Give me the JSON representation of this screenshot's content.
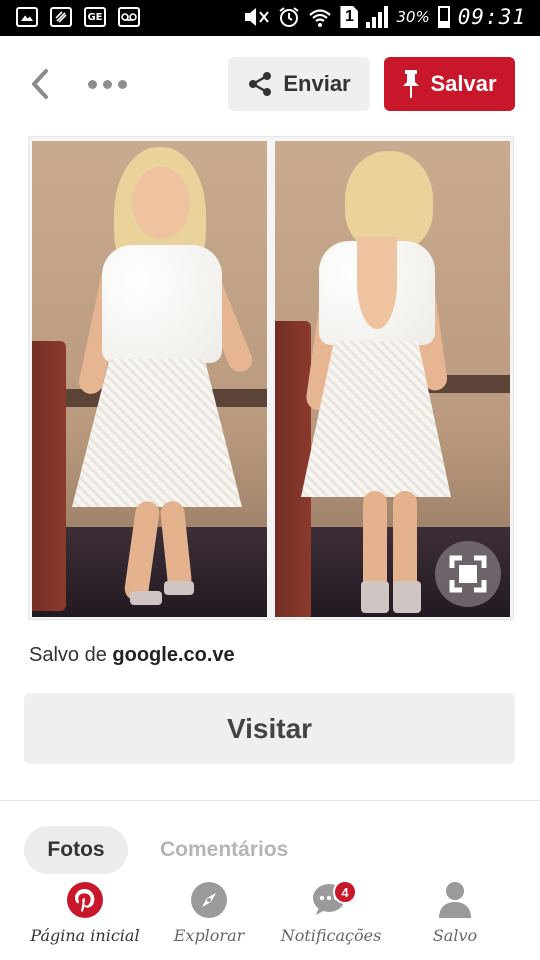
{
  "status_bar": {
    "icons": [
      "gallery-icon",
      "nfc-icon",
      "sim-icon",
      "voicemail-icon",
      "mute-icon",
      "alarm-icon",
      "wifi-icon",
      "sim-slot-icon",
      "signal-icon",
      "battery-icon"
    ],
    "sim_badge": "GE",
    "sim_slot": "1",
    "battery": "30%",
    "time": "09:31"
  },
  "toolbar": {
    "back_icon": "chevron-left-icon",
    "more_icon": "more-dots-icon",
    "send_label": "Enviar",
    "send_icon": "share-icon",
    "save_label": "Salvar",
    "save_icon": "pin-icon",
    "save_color": "#c8172a"
  },
  "pin": {
    "expand_icon": "expand-icon",
    "source_prefix": "Salvo de",
    "source_domain": "google.co.ve",
    "visit_label": "Visitar"
  },
  "tabs": [
    {
      "label": "Fotos",
      "active": true
    },
    {
      "label": "Comentários",
      "active": false
    }
  ],
  "nav": [
    {
      "label": "Página inicial",
      "icon": "pinterest-logo-icon",
      "active": true
    },
    {
      "label": "Explorar",
      "icon": "compass-icon",
      "active": false
    },
    {
      "label": "Notificações",
      "icon": "chat-bubble-icon",
      "badge": "4",
      "active": false
    },
    {
      "label": "Salvo",
      "icon": "profile-icon",
      "active": false
    }
  ]
}
